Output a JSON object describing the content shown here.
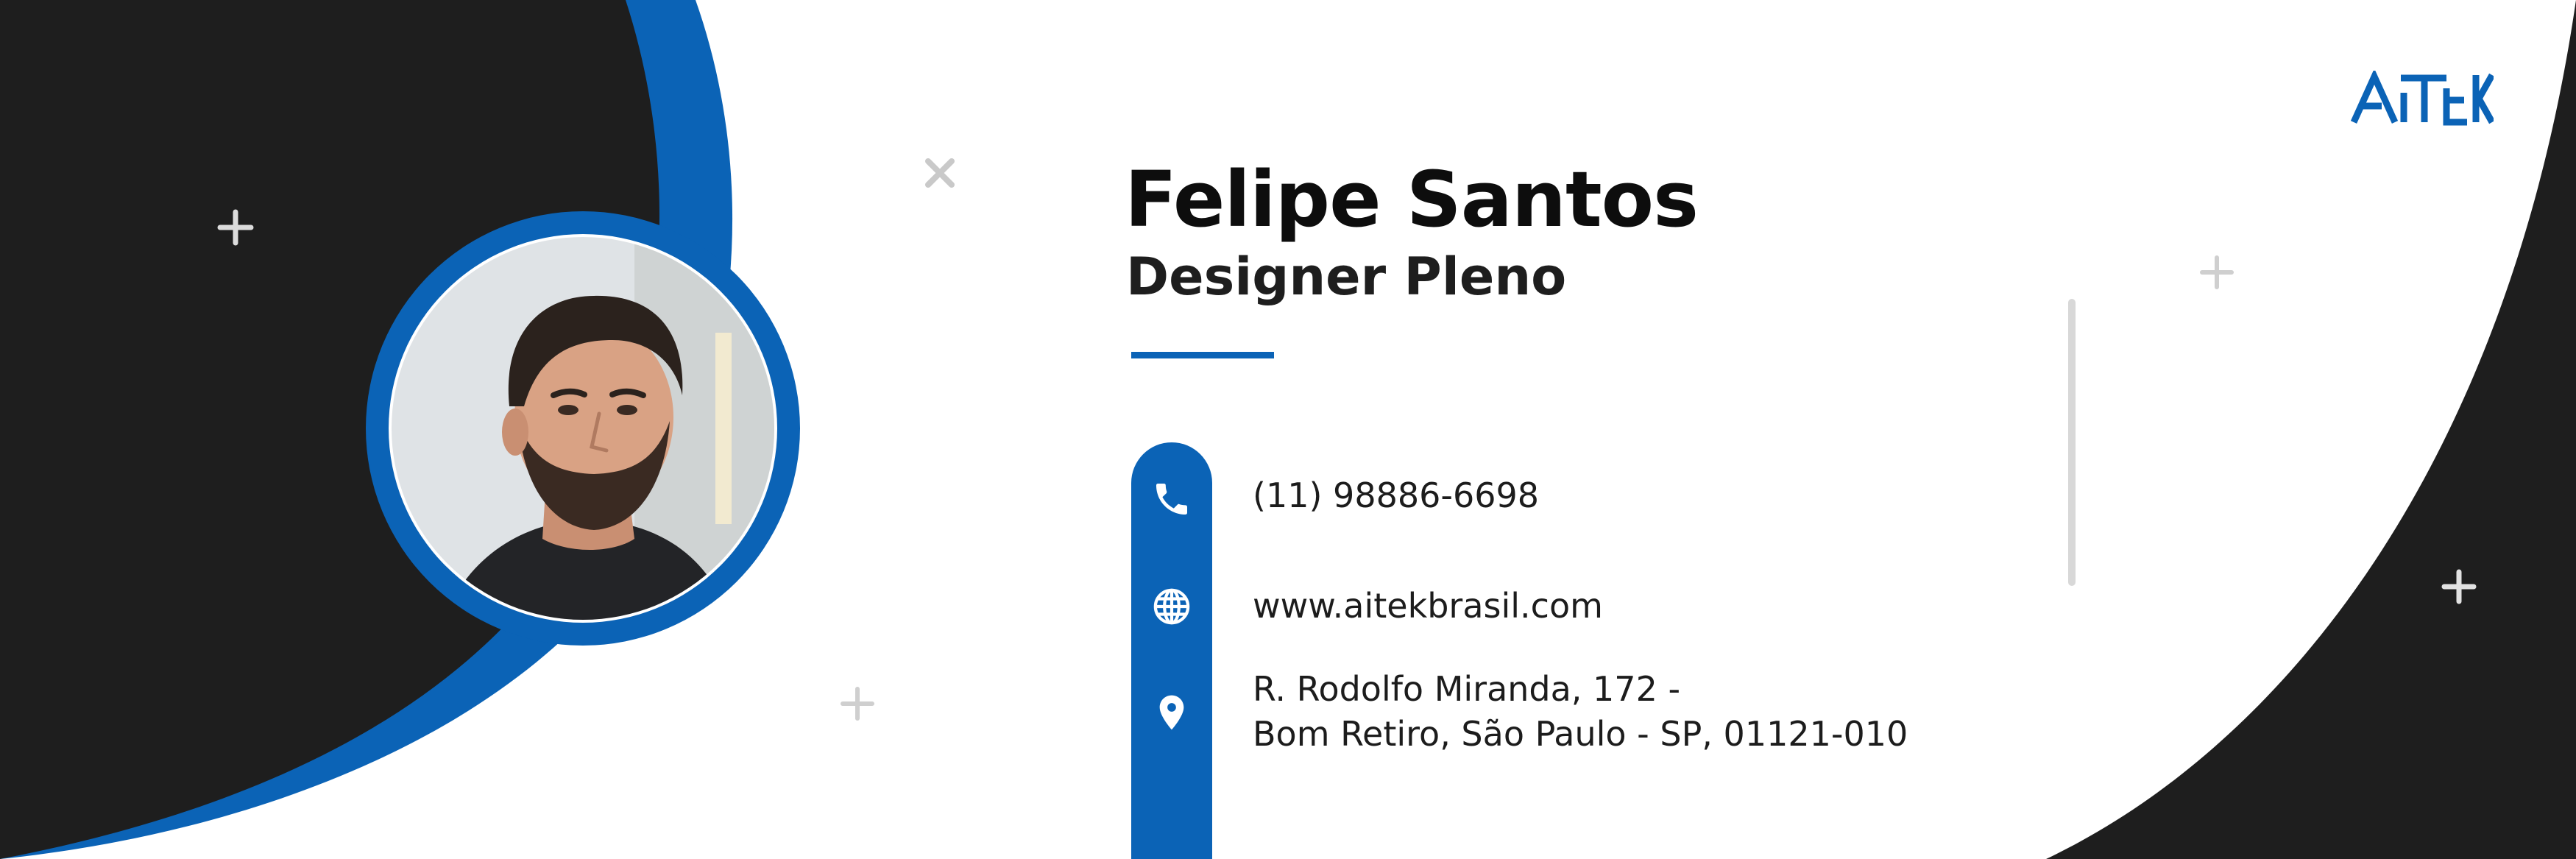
{
  "profile": {
    "name": "Felipe Santos",
    "role": "Designer Pleno"
  },
  "brand": {
    "logo_text": "AITEK",
    "accent_color": "#0B63B6",
    "dark_color": "#1E1E1E"
  },
  "contact": {
    "phone": "(11) 98886-6698",
    "website": "www.aitekbrasil.com",
    "address_line1": "R. Rodolfo Miranda, 172 -",
    "address_line2": "Bom Retiro, São Paulo - SP, 01121-010"
  },
  "icons": {
    "phone": "phone-icon",
    "website": "globe-icon",
    "address": "location-pin-icon"
  }
}
